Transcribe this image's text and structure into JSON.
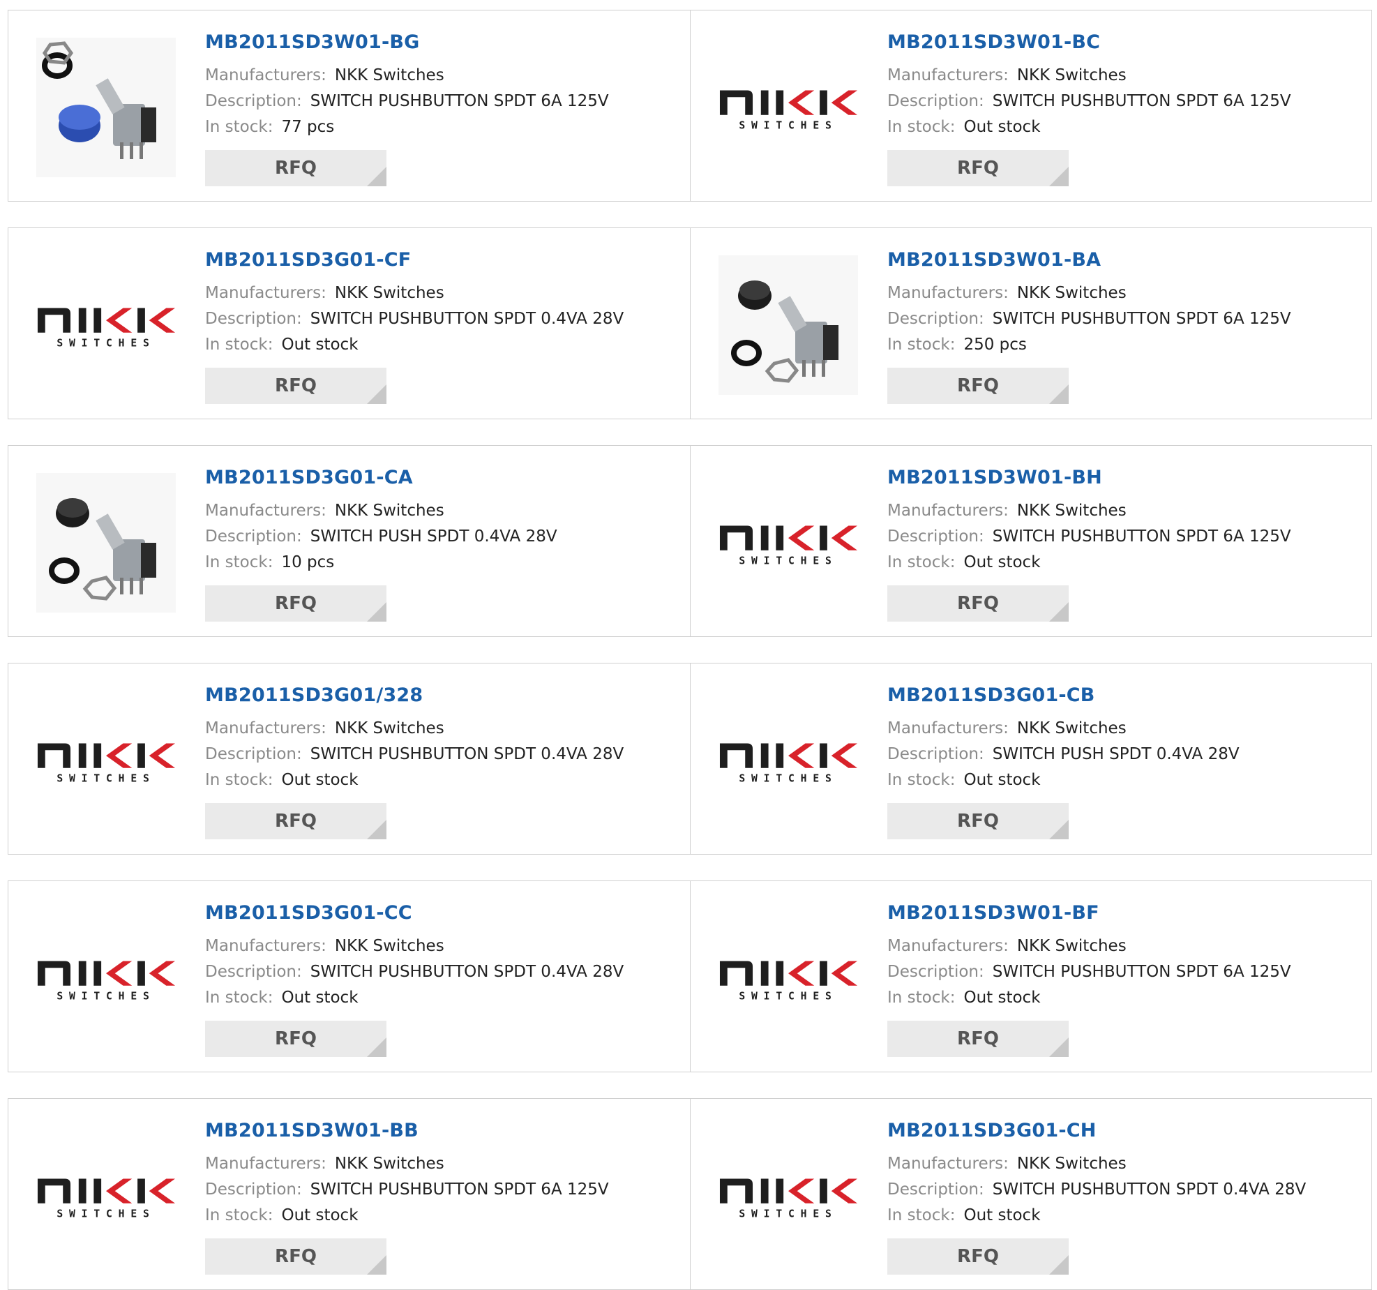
{
  "labels": {
    "manufacturers": "Manufacturers:",
    "description": "Description:",
    "stock": "In stock:",
    "rfq": "RFQ"
  },
  "colors": {
    "link": "#1a5fa8",
    "label": "#8a8a8a",
    "value": "#222222",
    "rfq_bg": "#eaeaea",
    "border": "#cfcfcf",
    "logo_black": "#1e1e1e",
    "logo_red": "#d8222a"
  },
  "logo": {
    "top": "nkk",
    "bottom": "SWITCHES"
  },
  "products": [
    {
      "pn": "MB2011SD3W01-BG",
      "manufacturer": "NKK Switches",
      "description": "SWITCH PUSHBUTTON SPDT 6A 125V",
      "stock": "77 pcs",
      "image": "switch-blue-cap-photo"
    },
    {
      "pn": "MB2011SD3W01-BC",
      "manufacturer": "NKK Switches",
      "description": "SWITCH PUSHBUTTON SPDT 6A 125V",
      "stock": "Out stock",
      "image": "nkk-logo"
    },
    {
      "pn": "MB2011SD3G01-CF",
      "manufacturer": "NKK Switches",
      "description": "SWITCH PUSHBUTTON SPDT 0.4VA 28V",
      "stock": "Out stock",
      "image": "nkk-logo"
    },
    {
      "pn": "MB2011SD3W01-BA",
      "manufacturer": "NKK Switches",
      "description": "SWITCH PUSHBUTTON SPDT 6A 125V",
      "stock": "250 pcs",
      "image": "switch-black-cap-photo"
    },
    {
      "pn": "MB2011SD3G01-CA",
      "manufacturer": "NKK Switches",
      "description": "SWITCH PUSH SPDT 0.4VA 28V",
      "stock": "10 pcs",
      "image": "switch-black-cap-photo"
    },
    {
      "pn": "MB2011SD3W01-BH",
      "manufacturer": "NKK Switches",
      "description": "SWITCH PUSHBUTTON SPDT 6A 125V",
      "stock": "Out stock",
      "image": "nkk-logo"
    },
    {
      "pn": "MB2011SD3G01/328",
      "manufacturer": "NKK Switches",
      "description": "SWITCH PUSHBUTTON SPDT 0.4VA 28V",
      "stock": "Out stock",
      "image": "nkk-logo"
    },
    {
      "pn": "MB2011SD3G01-CB",
      "manufacturer": "NKK Switches",
      "description": "SWITCH PUSH SPDT 0.4VA 28V",
      "stock": "Out stock",
      "image": "nkk-logo"
    },
    {
      "pn": "MB2011SD3G01-CC",
      "manufacturer": "NKK Switches",
      "description": "SWITCH PUSHBUTTON SPDT 0.4VA 28V",
      "stock": "Out stock",
      "image": "nkk-logo"
    },
    {
      "pn": "MB2011SD3W01-BF",
      "manufacturer": "NKK Switches",
      "description": "SWITCH PUSHBUTTON SPDT 6A 125V",
      "stock": "Out stock",
      "image": "nkk-logo"
    },
    {
      "pn": "MB2011SD3W01-BB",
      "manufacturer": "NKK Switches",
      "description": "SWITCH PUSHBUTTON SPDT 6A 125V",
      "stock": "Out stock",
      "image": "nkk-logo"
    },
    {
      "pn": "MB2011SD3G01-CH",
      "manufacturer": "NKK Switches",
      "description": "SWITCH PUSHBUTTON SPDT 0.4VA 28V",
      "stock": "Out stock",
      "image": "nkk-logo"
    }
  ]
}
